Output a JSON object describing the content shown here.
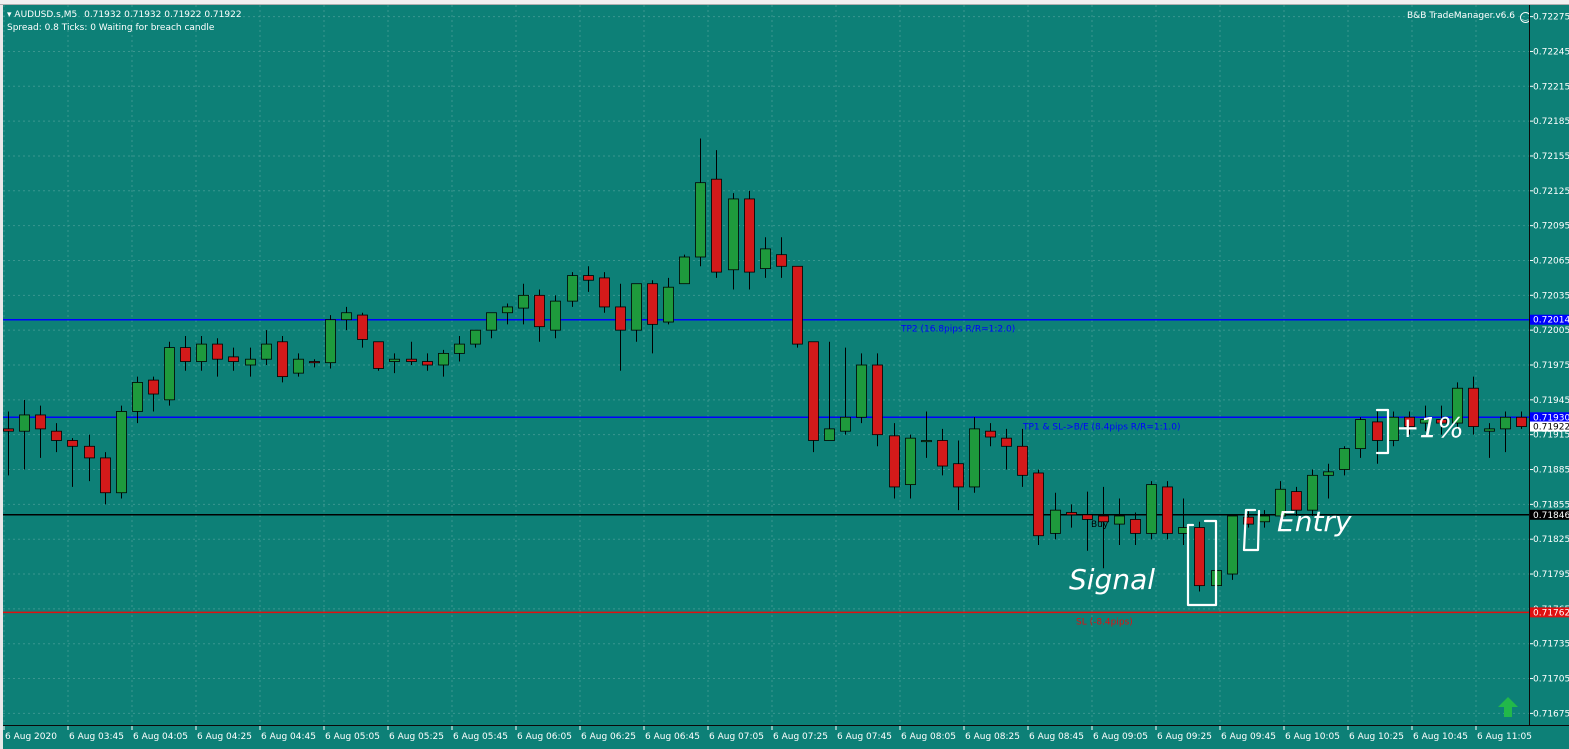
{
  "symbol_header": {
    "symbol": "AUDUSD.s,M5",
    "ohlc": "0.71932 0.71932 0.71922 0.71922",
    "status": "Spread: 0.8   Ticks: 0   Waiting for breach candle"
  },
  "ea_label": "B&B TradeManager.v6.6",
  "colors": {
    "background": "#0d8077",
    "bull": "#1e9a3c",
    "bear": "#d31a1a",
    "tp_line": "#0000ff",
    "entry_line": "#000000",
    "sl_line": "#e01010"
  },
  "price_axis": {
    "ticks": [
      "0.72275",
      "0.72245",
      "0.72215",
      "0.72185",
      "0.72155",
      "0.72125",
      "0.72095",
      "0.72065",
      "0.72035",
      "0.72005",
      "0.71975",
      "0.71945",
      "0.71915",
      "0.71885",
      "0.71855",
      "0.71825",
      "0.71795",
      "0.71765",
      "0.71735",
      "0.71705",
      "0.71675"
    ],
    "current_price": "0.71922"
  },
  "time_axis": {
    "labels": [
      "6 Aug 2020",
      "6 Aug 03:45",
      "6 Aug 04:05",
      "6 Aug 04:25",
      "6 Aug 04:45",
      "6 Aug 05:05",
      "6 Aug 05:25",
      "6 Aug 05:45",
      "6 Aug 06:05",
      "6 Aug 06:25",
      "6 Aug 06:45",
      "6 Aug 07:05",
      "6 Aug 07:25",
      "6 Aug 07:45",
      "6 Aug 08:05",
      "6 Aug 08:25",
      "6 Aug 08:45",
      "6 Aug 09:05",
      "6 Aug 09:25",
      "6 Aug 09:45",
      "6 Aug 10:05",
      "6 Aug 10:25",
      "6 Aug 10:45",
      "6 Aug 11:05"
    ]
  },
  "levels": {
    "tp2": {
      "price": "0.72014",
      "label": "TP2 (16.8pips R/R=1:2.0)"
    },
    "tp1": {
      "price": "0.71930",
      "label": "TP1 & SL->B/E (8.4pips R/R=1:1.0)"
    },
    "entry": {
      "price": "0.71846",
      "label": "Buy"
    },
    "sl": {
      "price": "0.71762",
      "label": "SL (-8.4pips)"
    }
  },
  "annotations": {
    "signal": "Signal",
    "entry": "Entry",
    "profit": "+1%"
  },
  "chart_data": {
    "type": "candlestick",
    "ylim": [
      0.71665,
      0.72285
    ],
    "ohlc": [
      [
        0.7192,
        0.71935,
        0.7188,
        0.71918
      ],
      [
        0.71918,
        0.71945,
        0.71885,
        0.71932
      ],
      [
        0.71932,
        0.7194,
        0.71895,
        0.7192
      ],
      [
        0.71918,
        0.71925,
        0.719,
        0.7191
      ],
      [
        0.7191,
        0.71912,
        0.7187,
        0.71905
      ],
      [
        0.71905,
        0.71915,
        0.71875,
        0.71895
      ],
      [
        0.71895,
        0.719,
        0.71855,
        0.71865
      ],
      [
        0.71865,
        0.7194,
        0.7186,
        0.71935
      ],
      [
        0.71935,
        0.71965,
        0.71925,
        0.7196
      ],
      [
        0.71962,
        0.71965,
        0.71935,
        0.7195
      ],
      [
        0.71945,
        0.71995,
        0.7194,
        0.7199
      ],
      [
        0.7199,
        0.72,
        0.7197,
        0.71978
      ],
      [
        0.71978,
        0.72,
        0.7197,
        0.71993
      ],
      [
        0.71993,
        0.71998,
        0.71965,
        0.7198
      ],
      [
        0.71982,
        0.7199,
        0.7197,
        0.71978
      ],
      [
        0.71975,
        0.7199,
        0.71965,
        0.7198
      ],
      [
        0.7198,
        0.72005,
        0.71975,
        0.71993
      ],
      [
        0.71995,
        0.72,
        0.7196,
        0.71965
      ],
      [
        0.71968,
        0.71985,
        0.71965,
        0.7198
      ],
      [
        0.71978,
        0.7198,
        0.71973,
        0.71977
      ],
      [
        0.71977,
        0.72018,
        0.71972,
        0.72014
      ],
      [
        0.72014,
        0.72025,
        0.72005,
        0.7202
      ],
      [
        0.72018,
        0.7202,
        0.7199,
        0.71997
      ],
      [
        0.71995,
        0.71995,
        0.7197,
        0.71972
      ],
      [
        0.71978,
        0.71985,
        0.71968,
        0.7198
      ],
      [
        0.7198,
        0.71995,
        0.71975,
        0.71978
      ],
      [
        0.71978,
        0.71985,
        0.7197,
        0.71975
      ],
      [
        0.71975,
        0.71988,
        0.71965,
        0.71985
      ],
      [
        0.71985,
        0.72,
        0.71978,
        0.71993
      ],
      [
        0.71993,
        0.72005,
        0.7199,
        0.72005
      ],
      [
        0.72005,
        0.7202,
        0.71998,
        0.7202
      ],
      [
        0.7202,
        0.72028,
        0.7201,
        0.72025
      ],
      [
        0.72024,
        0.72045,
        0.7201,
        0.72035
      ],
      [
        0.72035,
        0.7204,
        0.71995,
        0.72008
      ],
      [
        0.72005,
        0.72035,
        0.71998,
        0.7203
      ],
      [
        0.7203,
        0.72055,
        0.72025,
        0.72052
      ],
      [
        0.72052,
        0.7206,
        0.72038,
        0.72048
      ],
      [
        0.7205,
        0.72055,
        0.7202,
        0.72025
      ],
      [
        0.72025,
        0.72045,
        0.7197,
        0.72005
      ],
      [
        0.72005,
        0.72045,
        0.71995,
        0.72045
      ],
      [
        0.72045,
        0.72048,
        0.71985,
        0.7201
      ],
      [
        0.72012,
        0.7205,
        0.7201,
        0.72042
      ],
      [
        0.72045,
        0.7207,
        0.72045,
        0.72068
      ],
      [
        0.72068,
        0.7217,
        0.7206,
        0.72132
      ],
      [
        0.72135,
        0.7216,
        0.7205,
        0.72055
      ],
      [
        0.72057,
        0.72123,
        0.7204,
        0.72118
      ],
      [
        0.72118,
        0.72125,
        0.7204,
        0.72055
      ],
      [
        0.72058,
        0.72085,
        0.7205,
        0.72075
      ],
      [
        0.7207,
        0.72085,
        0.7205,
        0.7206
      ],
      [
        0.7206,
        0.7206,
        0.7199,
        0.71993
      ],
      [
        0.71995,
        0.71995,
        0.719,
        0.7191
      ],
      [
        0.7191,
        0.71995,
        0.7191,
        0.7192
      ],
      [
        0.71918,
        0.7199,
        0.71915,
        0.7193
      ],
      [
        0.7193,
        0.71985,
        0.71925,
        0.71975
      ],
      [
        0.71975,
        0.71985,
        0.71905,
        0.71915
      ],
      [
        0.71914,
        0.71925,
        0.7186,
        0.7187
      ],
      [
        0.71872,
        0.71915,
        0.7186,
        0.71912
      ],
      [
        0.7191,
        0.71935,
        0.71895,
        0.7191
      ],
      [
        0.7191,
        0.7192,
        0.7188,
        0.71888
      ],
      [
        0.7189,
        0.7191,
        0.7185,
        0.7187
      ],
      [
        0.7187,
        0.7193,
        0.71865,
        0.7192
      ],
      [
        0.71918,
        0.71925,
        0.71905,
        0.71913
      ],
      [
        0.71912,
        0.7192,
        0.71885,
        0.71905
      ],
      [
        0.71905,
        0.7192,
        0.7187,
        0.7188
      ],
      [
        0.71882,
        0.71885,
        0.7182,
        0.71828
      ],
      [
        0.7183,
        0.71865,
        0.71825,
        0.7185
      ],
      [
        0.71848,
        0.71855,
        0.71835,
        0.71846
      ],
      [
        0.71846,
        0.71866,
        0.71815,
        0.71842
      ],
      [
        0.71845,
        0.7187,
        0.718,
        0.7184
      ],
      [
        0.71838,
        0.7186,
        0.7182,
        0.71845
      ],
      [
        0.71842,
        0.71848,
        0.7182,
        0.7183
      ],
      [
        0.7183,
        0.71875,
        0.71825,
        0.71872
      ],
      [
        0.7187,
        0.71875,
        0.71825,
        0.7183
      ],
      [
        0.7183,
        0.7186,
        0.7182,
        0.71835
      ],
      [
        0.71835,
        0.7184,
        0.7178,
        0.71785
      ],
      [
        0.71785,
        0.71805,
        0.7177,
        0.71798
      ],
      [
        0.71795,
        0.71845,
        0.7179,
        0.71845
      ],
      [
        0.71844,
        0.7185,
        0.71835,
        0.71838
      ],
      [
        0.7184,
        0.7185,
        0.71835,
        0.71845
      ],
      [
        0.71845,
        0.71875,
        0.71838,
        0.71868
      ],
      [
        0.71866,
        0.7187,
        0.71845,
        0.7185
      ],
      [
        0.7185,
        0.71885,
        0.71845,
        0.7188
      ],
      [
        0.7188,
        0.7189,
        0.7186,
        0.71883
      ],
      [
        0.71885,
        0.71905,
        0.7188,
        0.71903
      ],
      [
        0.71903,
        0.7193,
        0.71895,
        0.71928
      ],
      [
        0.71926,
        0.71935,
        0.7189,
        0.7191
      ],
      [
        0.7191,
        0.71935,
        0.71905,
        0.7193
      ],
      [
        0.7193,
        0.71935,
        0.71915,
        0.71922
      ],
      [
        0.71925,
        0.7194,
        0.71918,
        0.71928
      ],
      [
        0.71928,
        0.7194,
        0.71915,
        0.71925
      ],
      [
        0.71925,
        0.7196,
        0.7192,
        0.71955
      ],
      [
        0.71955,
        0.71965,
        0.71915,
        0.71922
      ],
      [
        0.71918,
        0.71925,
        0.71895,
        0.7192
      ],
      [
        0.7192,
        0.71935,
        0.719,
        0.7193
      ],
      [
        0.7193,
        0.71935,
        0.7192,
        0.71922
      ]
    ]
  }
}
